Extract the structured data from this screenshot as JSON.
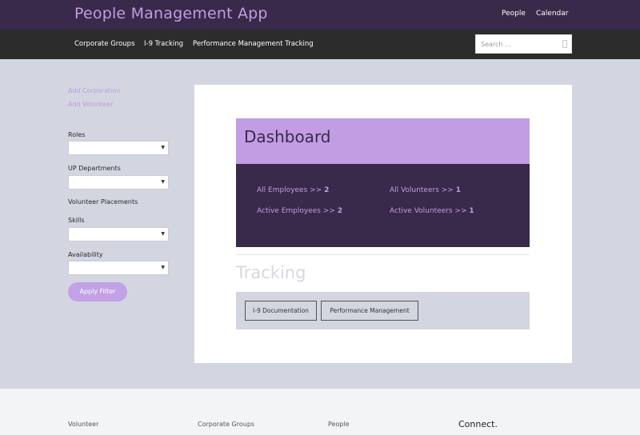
{
  "header": {
    "app_title": "People Management App",
    "links": [
      "People",
      "Calendar"
    ]
  },
  "nav": {
    "links": [
      "Corporate Groups",
      "I-9 Tracking",
      "Performance Management Tracking"
    ],
    "search_placeholder": "Search ..."
  },
  "sidebar": {
    "actions": [
      "Add Corporation",
      "Add Volunteer"
    ],
    "roles_label": "Roles",
    "departments_label": "UP Departments",
    "placements_label": "Volunteer Placements",
    "skills_label": "Skills",
    "availability_label": "Availability",
    "apply_label": "Apply Filter"
  },
  "dashboard": {
    "title": "Dashboard",
    "stats": [
      {
        "label": "All Employees >>",
        "value": "2"
      },
      {
        "label": "All Volunteers >>",
        "value": "1"
      },
      {
        "label": "Active Employees >>",
        "value": "2"
      },
      {
        "label": "Active Volunteers >>",
        "value": "1"
      }
    ]
  },
  "tracking": {
    "title": "Tracking",
    "buttons": [
      "I-9 Documentation",
      "Performance Management"
    ]
  },
  "footer": {
    "columns": [
      "Volunteer",
      "Corporate Groups",
      "People"
    ],
    "connect": "Connect."
  },
  "colors": {
    "brand_dark": "#39294a",
    "brand_light": "#c29de3",
    "background": "#d3d6e0"
  }
}
